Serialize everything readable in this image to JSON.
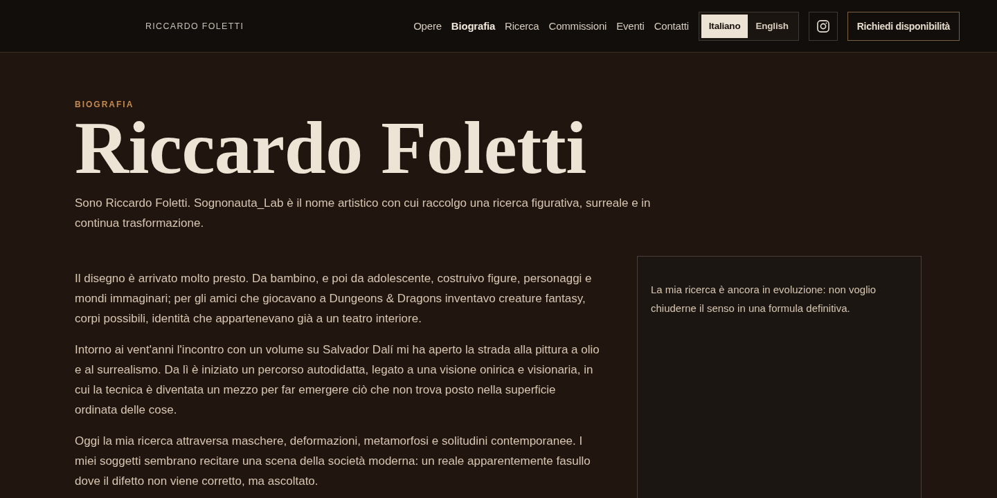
{
  "header": {
    "brand": "RICCARDO FOLETTI",
    "nav": [
      {
        "label": "Opere",
        "selected": false
      },
      {
        "label": "Biografia",
        "selected": true
      },
      {
        "label": "Ricerca",
        "selected": false
      },
      {
        "label": "Commissioni",
        "selected": false
      },
      {
        "label": "Eventi",
        "selected": false
      },
      {
        "label": "Contatti",
        "selected": false
      }
    ],
    "languages": [
      {
        "label": "Italiano",
        "selected": true
      },
      {
        "label": "English",
        "selected": false
      }
    ],
    "cta": "Richiedi disponibilità"
  },
  "hero": {
    "eyebrow": "BIOGRAFIA",
    "title": "Riccardo Foletti",
    "lead": "Sono Riccardo Foletti. Sognonauta_Lab è il nome artistico con cui raccolgo una ricerca figurativa, surreale e in continua trasformazione."
  },
  "body": {
    "paragraphs": [
      "Il disegno è arrivato molto presto. Da bambino, e poi da adolescente, costruivo figure, personaggi e mondi immaginari; per gli amici che giocavano a Dungeons & Dragons inventavo creature fantasy, corpi possibili, identità che appartenevano già a un teatro interiore.",
      "Intorno ai vent'anni l'incontro con un volume su Salvador Dalí mi ha aperto la strada alla pittura a olio e al surrealismo. Da lì è iniziato un percorso autodidatta, legato a una visione onirica e visionaria, in cui la tecnica è diventata un mezzo per far emergere ciò che non trova posto nella superficie ordinata delle cose.",
      "Oggi la mia ricerca attraversa maschere, deformazioni, metamorfosi e solitudini contemporanee. I miei soggetti sembrano recitare una scena della società moderna: un reale apparentemente fasullo dove il difetto non viene corretto, ma ascoltato."
    ],
    "aside": "La mia ricerca è ancora in evoluzione: non voglio chiuderne il senso in una formula definitiva."
  }
}
